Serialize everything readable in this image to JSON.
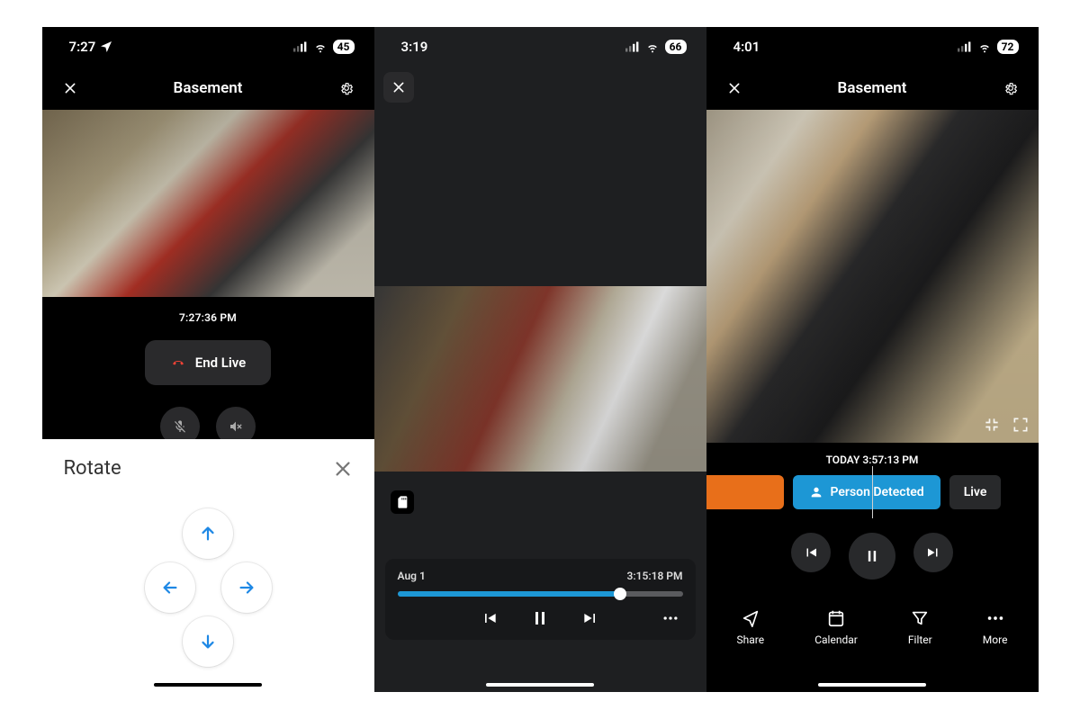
{
  "phones": {
    "p1": {
      "status": {
        "time": "7:27",
        "battery": "45"
      },
      "header": {
        "title": "Basement"
      },
      "timestamp": "7:27:36 PM",
      "end_live_label": "End Live",
      "sheet": {
        "title": "Rotate"
      }
    },
    "p2": {
      "status": {
        "time": "3:19",
        "battery": "66"
      },
      "playback": {
        "date": "Aug 1",
        "time": "3:15:18 PM",
        "progress_pct": 78
      }
    },
    "p3": {
      "status": {
        "time": "4:01",
        "battery": "72"
      },
      "header": {
        "title": "Basement"
      },
      "timestamp_label": "TODAY 3:57:13 PM",
      "chips": {
        "detected": "Person Detected",
        "live": "Live"
      },
      "tools": {
        "share": "Share",
        "calendar": "Calendar",
        "filter": "Filter",
        "more": "More"
      }
    }
  }
}
